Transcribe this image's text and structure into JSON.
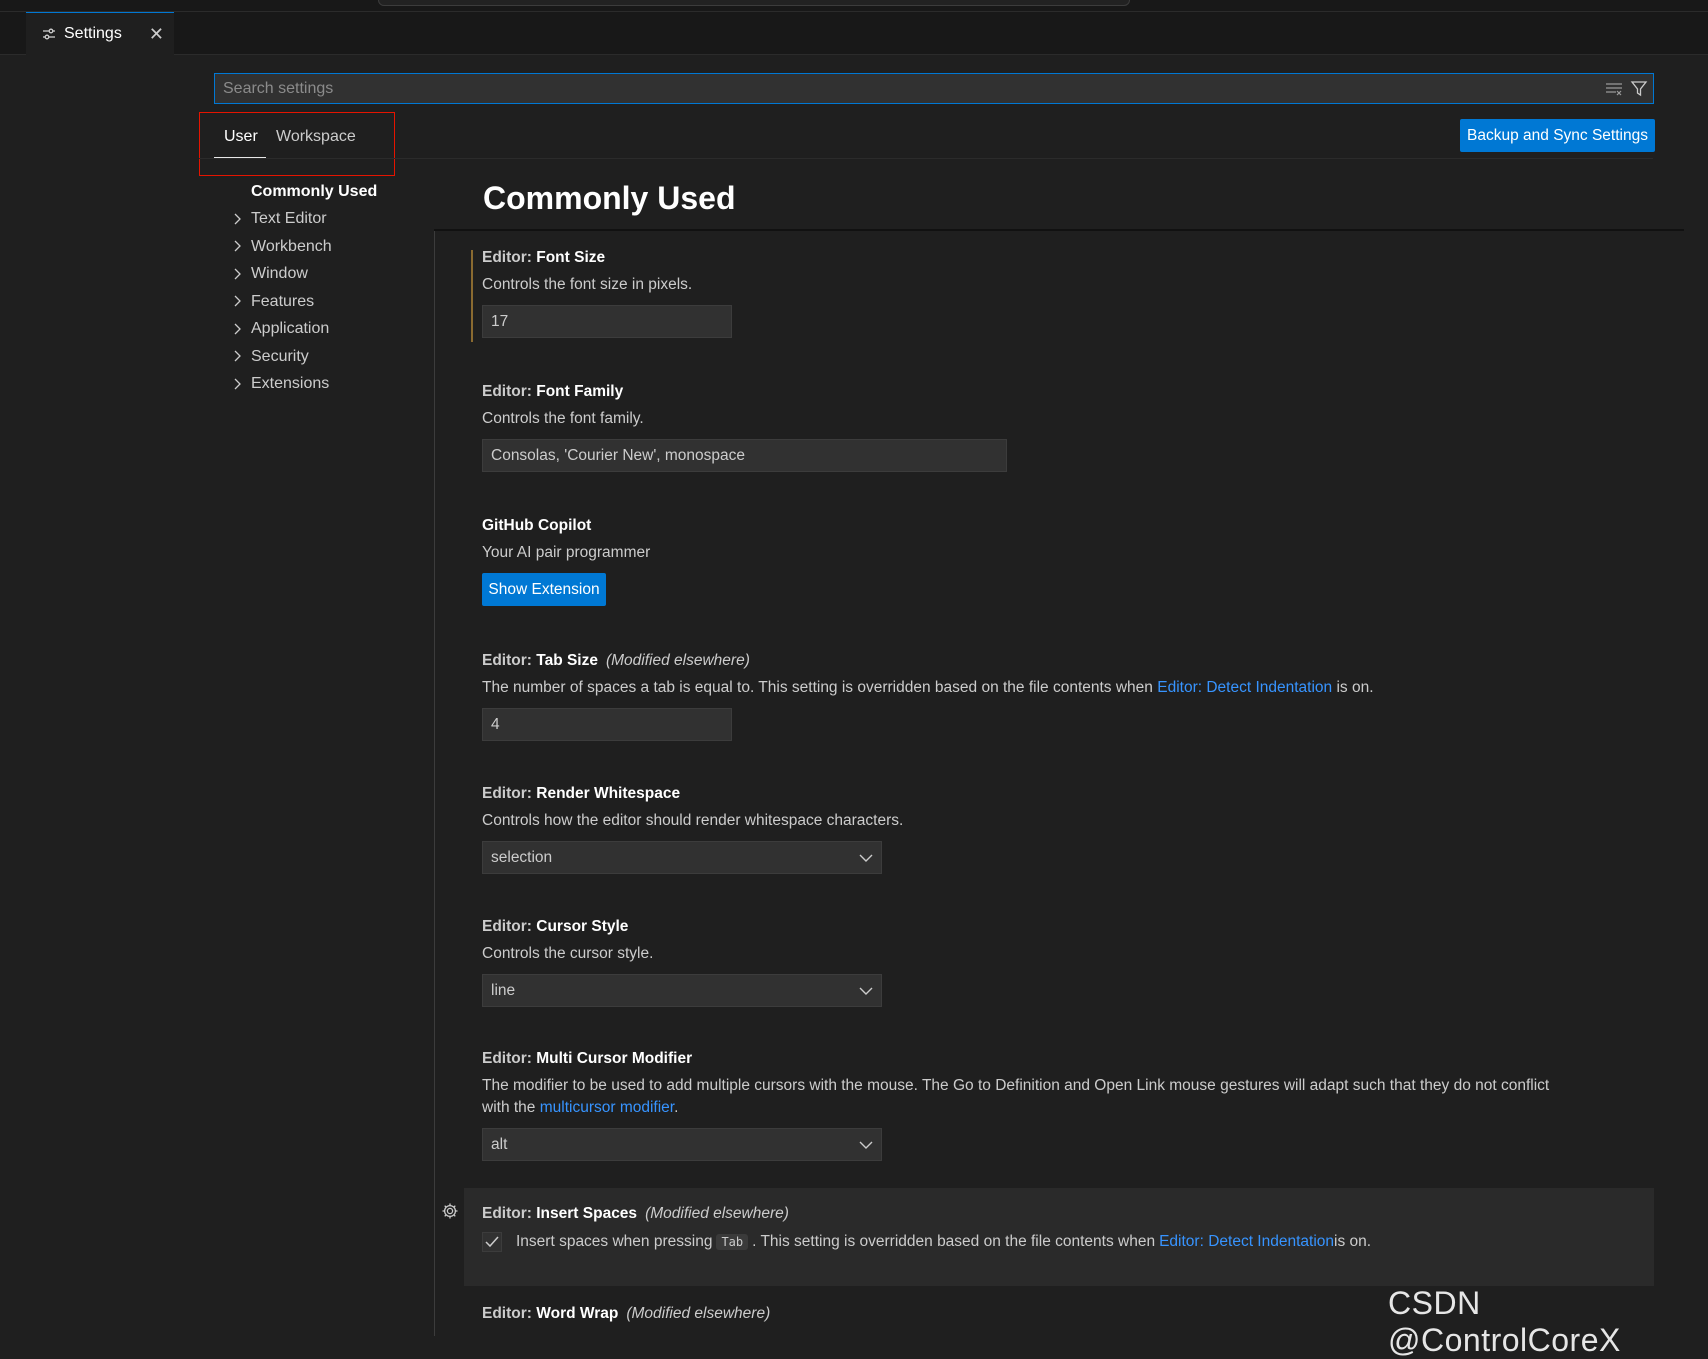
{
  "tab": {
    "label": "Settings",
    "icon": "settings-sliders-icon",
    "close": "✕"
  },
  "search": {
    "placeholder": "Search settings"
  },
  "scope": {
    "user": "User",
    "workspace": "Workspace"
  },
  "sync_button": "Backup and Sync Settings",
  "toc": [
    {
      "label": "Commonly Used",
      "expandable": false,
      "active": true
    },
    {
      "label": "Text Editor",
      "expandable": true
    },
    {
      "label": "Workbench",
      "expandable": true
    },
    {
      "label": "Window",
      "expandable": true
    },
    {
      "label": "Features",
      "expandable": true
    },
    {
      "label": "Application",
      "expandable": true
    },
    {
      "label": "Security",
      "expandable": true
    },
    {
      "label": "Extensions",
      "expandable": true
    }
  ],
  "page_title": "Commonly Used",
  "settings": {
    "font_size": {
      "category": "Editor: ",
      "name": "Font Size",
      "desc": "Controls the font size in pixels.",
      "value": "17"
    },
    "font_family": {
      "category": "Editor: ",
      "name": "Font Family",
      "desc": "Controls the font family.",
      "value": "Consolas, 'Courier New', monospace"
    },
    "copilot": {
      "name": "GitHub Copilot",
      "desc": "Your AI pair programmer",
      "button": "Show Extension"
    },
    "tab_size": {
      "category": "Editor: ",
      "name": "Tab Size",
      "modified": "(Modified elsewhere)",
      "desc_before": "The number of spaces a tab is equal to. This setting is overridden based on the file contents when ",
      "desc_link": "Editor: Detect Indentation",
      "desc_after": " is on.",
      "value": "4"
    },
    "render_whitespace": {
      "category": "Editor: ",
      "name": "Render Whitespace",
      "desc": "Controls how the editor should render whitespace characters.",
      "value": "selection"
    },
    "cursor_style": {
      "category": "Editor: ",
      "name": "Cursor Style",
      "desc": "Controls the cursor style.",
      "value": "line"
    },
    "multi_cursor": {
      "category": "Editor: ",
      "name": "Multi Cursor Modifier",
      "desc_line1": "The modifier to be used to add multiple cursors with the mouse. The Go to Definition and Open Link mouse gestures will adapt such that they do not conflict",
      "desc_line2_before": "with the ",
      "desc_link": "multicursor modifier",
      "desc_line2_after": ".",
      "value": "alt"
    },
    "insert_spaces": {
      "category": "Editor: ",
      "name": "Insert Spaces",
      "modified": "(Modified elsewhere)",
      "checked": true,
      "desc_before": "Insert spaces when pressing ",
      "key": "Tab",
      "desc_middle": ". This setting is overridden based on the file contents when ",
      "desc_link": "Editor: Detect Indentation",
      "desc_after": " is on."
    },
    "word_wrap": {
      "category": "Editor: ",
      "name": "Word Wrap",
      "modified": "(Modified elsewhere)"
    }
  },
  "watermark": "CSDN @ControlCoreX",
  "colors": {
    "accent": "#0078d4",
    "link": "#3794ff",
    "background": "#1f1f1f",
    "highlight_box": "#e51400"
  }
}
